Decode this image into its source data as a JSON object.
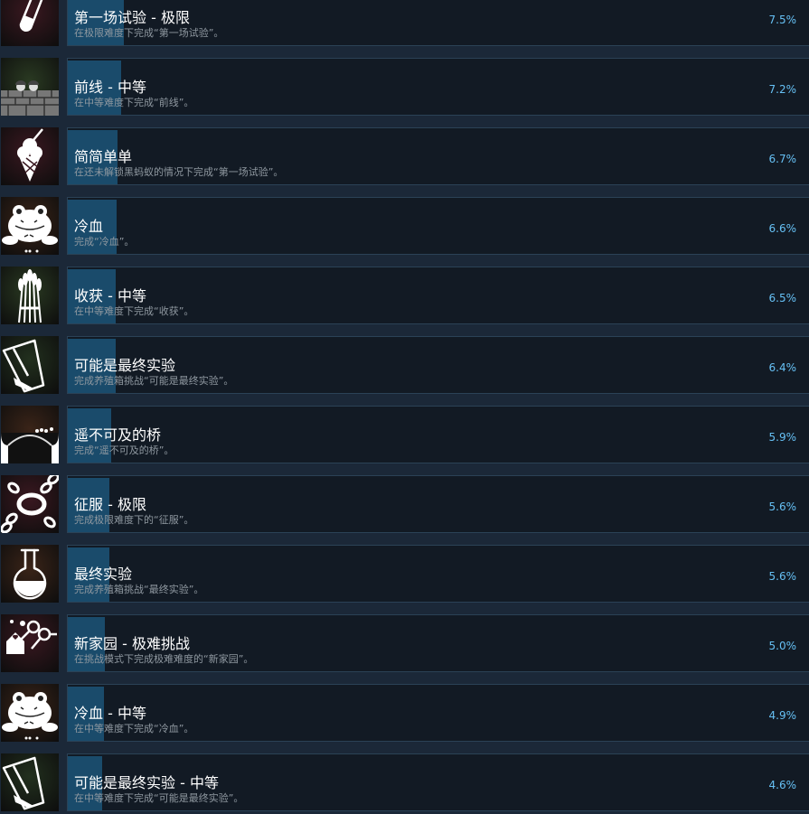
{
  "achievements": [
    {
      "name": "第一场试验 - 极限",
      "desc": "在极限难度下完成“第一场试验”。",
      "percent": "7.5%",
      "rate": 7.5,
      "icon": "test-tube-icon",
      "bg": "#3a1820"
    },
    {
      "name": "前线 - 中等",
      "desc": "在中等难度下完成“前线”。",
      "percent": "7.2%",
      "rate": 7.2,
      "icon": "trench-soldiers-icon",
      "bg": "#2a3a22"
    },
    {
      "name": "简简单单",
      "desc": "在还未解锁黑蚂蚁的情况下完成“第一场试验”。",
      "percent": "6.7%",
      "rate": 6.7,
      "icon": "ice-cream-icon",
      "bg": "#3a1820"
    },
    {
      "name": "冷血",
      "desc": "完成“冷血”。",
      "percent": "6.6%",
      "rate": 6.6,
      "icon": "toad-icon",
      "bg": "#3a2418"
    },
    {
      "name": "收获 - 中等",
      "desc": "在中等难度下完成“收获”。",
      "percent": "6.5%",
      "rate": 6.5,
      "icon": "wheat-icon",
      "bg": "#2a3a22"
    },
    {
      "name": "可能是最终实验",
      "desc": "完成养殖箱挑战“可能是最终实验”。",
      "percent": "6.4%",
      "rate": 6.4,
      "icon": "beaker-icon",
      "bg": "#22301e"
    },
    {
      "name": "遥不可及的桥",
      "desc": "完成“遥不可及的桥”。",
      "percent": "5.9%",
      "rate": 5.9,
      "icon": "bridge-ants-icon",
      "bg": "#3a2418"
    },
    {
      "name": "征服 - 极限",
      "desc": "完成极限难度下的“征服”。",
      "percent": "5.6%",
      "rate": 5.6,
      "icon": "chain-ring-icon",
      "bg": "#3a1820"
    },
    {
      "name": "最终实验",
      "desc": "完成养殖箱挑战“最终实验”。",
      "percent": "5.6%",
      "rate": 5.6,
      "icon": "flask-icon",
      "bg": "#3a2418"
    },
    {
      "name": "新家园 - 极难挑战",
      "desc": "在挑战模式下完成极难难度的“新家园”。",
      "percent": "5.0%",
      "rate": 5.0,
      "icon": "house-keys-icon",
      "bg": "#3a1820"
    },
    {
      "name": "冷血 - 中等",
      "desc": "在中等难度下完成“冷血”。",
      "percent": "4.9%",
      "rate": 4.9,
      "icon": "toad-icon",
      "bg": "#3a2418"
    },
    {
      "name": "可能是最终实验 - 中等",
      "desc": "在中等难度下完成“可能是最终实验”。",
      "percent": "4.6%",
      "rate": 4.6,
      "icon": "beaker-icon",
      "bg": "#22301e"
    }
  ]
}
